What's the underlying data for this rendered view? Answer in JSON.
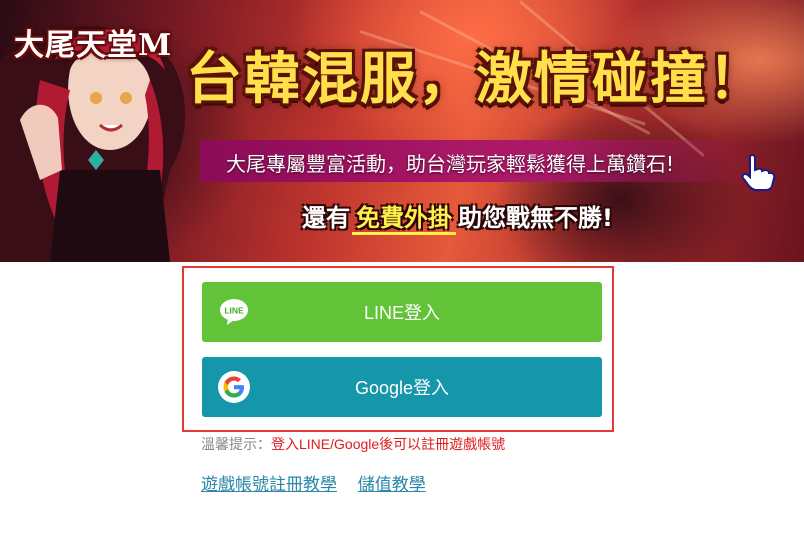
{
  "banner": {
    "logo": "大尾天堂M",
    "headline": "台韓混服，激情碰撞！",
    "subline": "大尾專屬豐富活動，助台灣玩家輕鬆獲得上萬鑽石!",
    "bottom_prefix": "還有",
    "bottom_highlight": "免費外掛",
    "bottom_suffix": "助您戰無不勝!"
  },
  "login": {
    "line_label": "LINE登入",
    "google_label": "Google登入",
    "line_icon": "line-icon",
    "google_icon": "google-icon",
    "line_color": "#63c338",
    "google_color": "#1596aa",
    "highlight_border_color": "#e53935"
  },
  "hint": {
    "prefix": "溫馨提示：",
    "message": "登入LINE/Google後可以註冊遊戲帳號"
  },
  "links": [
    {
      "label": "遊戲帳號註冊教學"
    },
    {
      "label": "儲值教學"
    }
  ]
}
